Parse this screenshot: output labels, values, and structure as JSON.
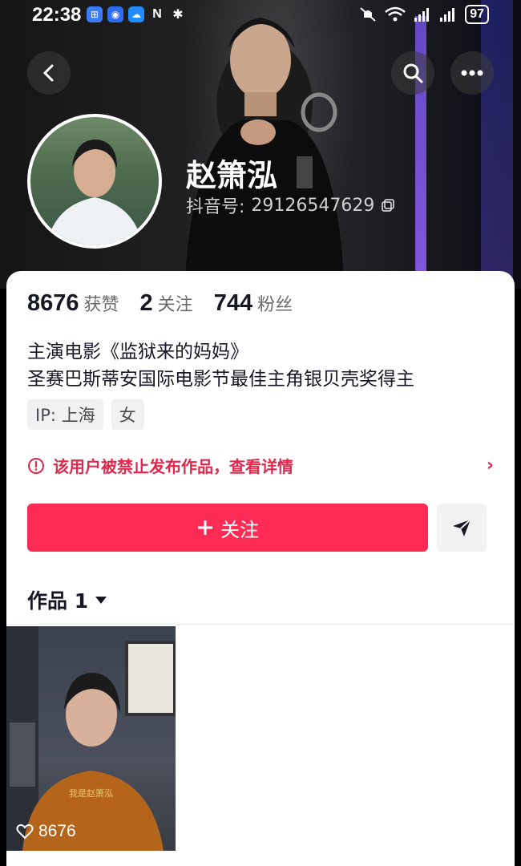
{
  "status_bar": {
    "time": "22:38",
    "battery": "97"
  },
  "header": {
    "back_icon": "chevron-left-icon",
    "search_icon": "search-icon",
    "more_icon": "more-horizontal-icon"
  },
  "profile": {
    "name": "赵箫泓",
    "id_label": "抖音号:",
    "id_value": "29126547629"
  },
  "stats": {
    "likes_value": "8676",
    "likes_label": "获赞",
    "following_value": "2",
    "following_label": "关注",
    "followers_value": "744",
    "followers_label": "粉丝"
  },
  "bio": {
    "line1": "主演电影《监狱来的妈妈》",
    "line2": "圣赛巴斯蒂安国际电影节最佳主角银贝壳奖得主"
  },
  "tags": {
    "ip": "IP:  上海",
    "gender": "女"
  },
  "warning": {
    "text": "该用户被禁止发布作品，查看详情"
  },
  "actions": {
    "follow_label": "关注"
  },
  "works": {
    "tab_label": "作品 1"
  },
  "video": {
    "like_count": "8676",
    "caption": "我是赵箫泓"
  },
  "colors": {
    "accent": "#fe2c55",
    "warning": "#e0284d",
    "text_primary": "#161823",
    "text_secondary": "#6a6a6f"
  }
}
